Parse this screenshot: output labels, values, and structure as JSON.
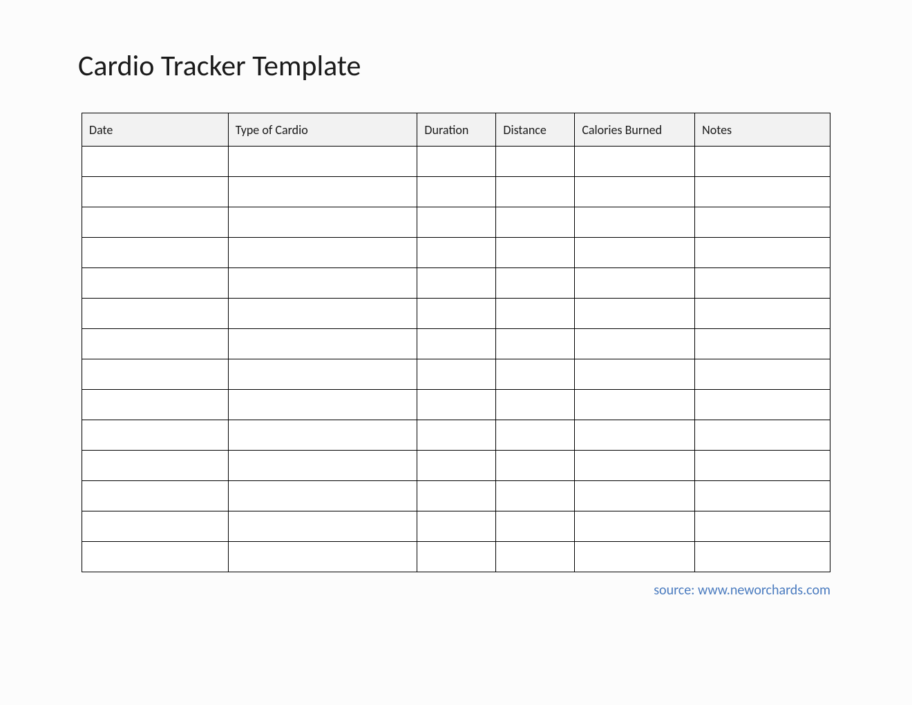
{
  "title": "Cardio Tracker Template",
  "columns": [
    {
      "label": "Date",
      "class": "col-date"
    },
    {
      "label": "Type of Cardio",
      "class": "col-type"
    },
    {
      "label": "Duration",
      "class": "col-duration"
    },
    {
      "label": "Distance",
      "class": "col-distance"
    },
    {
      "label": "Calories Burned",
      "class": "col-calories"
    },
    {
      "label": "Notes",
      "class": "col-notes"
    }
  ],
  "row_count": 14,
  "source": "source: www.neworchards.com"
}
